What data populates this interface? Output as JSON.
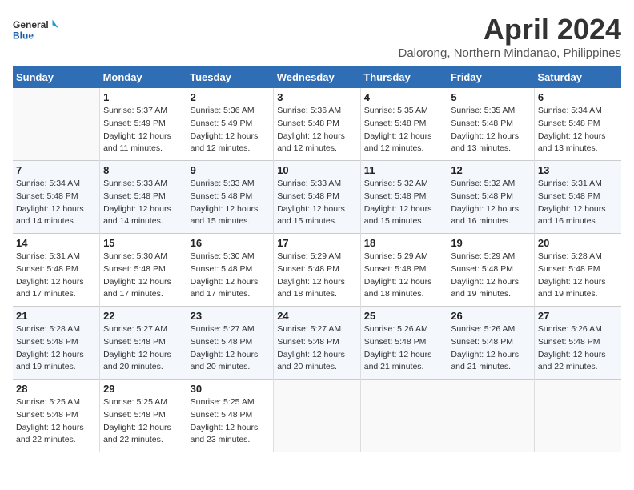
{
  "header": {
    "logo_line1": "General",
    "logo_line2": "Blue",
    "month_year": "April 2024",
    "location": "Dalorong, Northern Mindanao, Philippines"
  },
  "weekdays": [
    "Sunday",
    "Monday",
    "Tuesday",
    "Wednesday",
    "Thursday",
    "Friday",
    "Saturday"
  ],
  "weeks": [
    [
      {
        "day": "",
        "detail": ""
      },
      {
        "day": "1",
        "detail": "Sunrise: 5:37 AM\nSunset: 5:49 PM\nDaylight: 12 hours\nand 11 minutes."
      },
      {
        "day": "2",
        "detail": "Sunrise: 5:36 AM\nSunset: 5:49 PM\nDaylight: 12 hours\nand 12 minutes."
      },
      {
        "day": "3",
        "detail": "Sunrise: 5:36 AM\nSunset: 5:48 PM\nDaylight: 12 hours\nand 12 minutes."
      },
      {
        "day": "4",
        "detail": "Sunrise: 5:35 AM\nSunset: 5:48 PM\nDaylight: 12 hours\nand 12 minutes."
      },
      {
        "day": "5",
        "detail": "Sunrise: 5:35 AM\nSunset: 5:48 PM\nDaylight: 12 hours\nand 13 minutes."
      },
      {
        "day": "6",
        "detail": "Sunrise: 5:34 AM\nSunset: 5:48 PM\nDaylight: 12 hours\nand 13 minutes."
      }
    ],
    [
      {
        "day": "7",
        "detail": "Sunrise: 5:34 AM\nSunset: 5:48 PM\nDaylight: 12 hours\nand 14 minutes."
      },
      {
        "day": "8",
        "detail": "Sunrise: 5:33 AM\nSunset: 5:48 PM\nDaylight: 12 hours\nand 14 minutes."
      },
      {
        "day": "9",
        "detail": "Sunrise: 5:33 AM\nSunset: 5:48 PM\nDaylight: 12 hours\nand 15 minutes."
      },
      {
        "day": "10",
        "detail": "Sunrise: 5:33 AM\nSunset: 5:48 PM\nDaylight: 12 hours\nand 15 minutes."
      },
      {
        "day": "11",
        "detail": "Sunrise: 5:32 AM\nSunset: 5:48 PM\nDaylight: 12 hours\nand 15 minutes."
      },
      {
        "day": "12",
        "detail": "Sunrise: 5:32 AM\nSunset: 5:48 PM\nDaylight: 12 hours\nand 16 minutes."
      },
      {
        "day": "13",
        "detail": "Sunrise: 5:31 AM\nSunset: 5:48 PM\nDaylight: 12 hours\nand 16 minutes."
      }
    ],
    [
      {
        "day": "14",
        "detail": "Sunrise: 5:31 AM\nSunset: 5:48 PM\nDaylight: 12 hours\nand 17 minutes."
      },
      {
        "day": "15",
        "detail": "Sunrise: 5:30 AM\nSunset: 5:48 PM\nDaylight: 12 hours\nand 17 minutes."
      },
      {
        "day": "16",
        "detail": "Sunrise: 5:30 AM\nSunset: 5:48 PM\nDaylight: 12 hours\nand 17 minutes."
      },
      {
        "day": "17",
        "detail": "Sunrise: 5:29 AM\nSunset: 5:48 PM\nDaylight: 12 hours\nand 18 minutes."
      },
      {
        "day": "18",
        "detail": "Sunrise: 5:29 AM\nSunset: 5:48 PM\nDaylight: 12 hours\nand 18 minutes."
      },
      {
        "day": "19",
        "detail": "Sunrise: 5:29 AM\nSunset: 5:48 PM\nDaylight: 12 hours\nand 19 minutes."
      },
      {
        "day": "20",
        "detail": "Sunrise: 5:28 AM\nSunset: 5:48 PM\nDaylight: 12 hours\nand 19 minutes."
      }
    ],
    [
      {
        "day": "21",
        "detail": "Sunrise: 5:28 AM\nSunset: 5:48 PM\nDaylight: 12 hours\nand 19 minutes."
      },
      {
        "day": "22",
        "detail": "Sunrise: 5:27 AM\nSunset: 5:48 PM\nDaylight: 12 hours\nand 20 minutes."
      },
      {
        "day": "23",
        "detail": "Sunrise: 5:27 AM\nSunset: 5:48 PM\nDaylight: 12 hours\nand 20 minutes."
      },
      {
        "day": "24",
        "detail": "Sunrise: 5:27 AM\nSunset: 5:48 PM\nDaylight: 12 hours\nand 20 minutes."
      },
      {
        "day": "25",
        "detail": "Sunrise: 5:26 AM\nSunset: 5:48 PM\nDaylight: 12 hours\nand 21 minutes."
      },
      {
        "day": "26",
        "detail": "Sunrise: 5:26 AM\nSunset: 5:48 PM\nDaylight: 12 hours\nand 21 minutes."
      },
      {
        "day": "27",
        "detail": "Sunrise: 5:26 AM\nSunset: 5:48 PM\nDaylight: 12 hours\nand 22 minutes."
      }
    ],
    [
      {
        "day": "28",
        "detail": "Sunrise: 5:25 AM\nSunset: 5:48 PM\nDaylight: 12 hours\nand 22 minutes."
      },
      {
        "day": "29",
        "detail": "Sunrise: 5:25 AM\nSunset: 5:48 PM\nDaylight: 12 hours\nand 22 minutes."
      },
      {
        "day": "30",
        "detail": "Sunrise: 5:25 AM\nSunset: 5:48 PM\nDaylight: 12 hours\nand 23 minutes."
      },
      {
        "day": "",
        "detail": ""
      },
      {
        "day": "",
        "detail": ""
      },
      {
        "day": "",
        "detail": ""
      },
      {
        "day": "",
        "detail": ""
      }
    ]
  ]
}
